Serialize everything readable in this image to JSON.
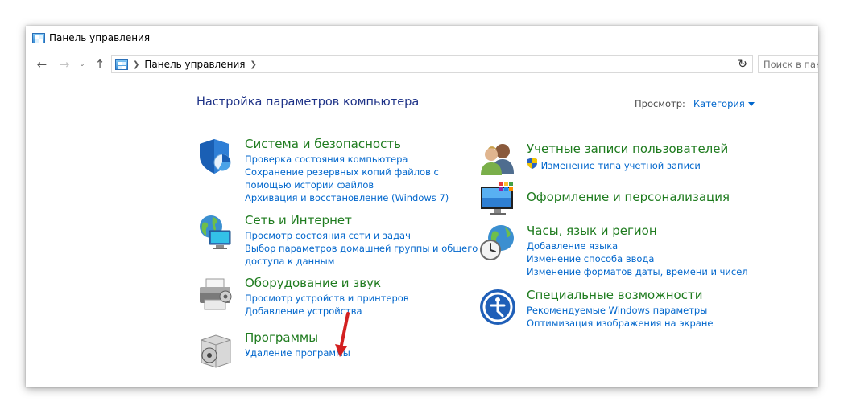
{
  "window": {
    "title": "Панель управления"
  },
  "nav": {
    "breadcrumb": "Панель управления",
    "search_placeholder": "Поиск в пан"
  },
  "main": {
    "heading": "Настройка параметров компьютера",
    "view_by_label": "Просмотр:",
    "view_by_value": "Категория"
  },
  "categories_left": [
    {
      "title": "Система и безопасность",
      "links": [
        "Проверка состояния компьютера",
        "Сохранение резервных копий файлов с помощью истории файлов",
        "Архивация и восстановление (Windows 7)"
      ]
    },
    {
      "title": "Сеть и Интернет",
      "links": [
        "Просмотр состояния сети и задач",
        "Выбор параметров домашней группы и общего доступа к данным"
      ]
    },
    {
      "title": "Оборудование и звук",
      "links": [
        "Просмотр устройств и принтеров",
        "Добавление устройства"
      ]
    },
    {
      "title": "Программы",
      "links": [
        "Удаление программы"
      ]
    }
  ],
  "categories_right": [
    {
      "title": "Учетные записи пользователей",
      "links": [
        "Изменение типа учетной записи"
      ]
    },
    {
      "title": "Оформление и персонализация",
      "links": []
    },
    {
      "title": "Часы, язык и регион",
      "links": [
        "Добавление языка",
        "Изменение способа ввода",
        "Изменение форматов даты, времени и чисел"
      ]
    },
    {
      "title": "Специальные возможности",
      "links": [
        "Рекомендуемые Windows параметры",
        "Оптимизация изображения на экране"
      ]
    }
  ],
  "annotation": {
    "color": "#d32020"
  }
}
